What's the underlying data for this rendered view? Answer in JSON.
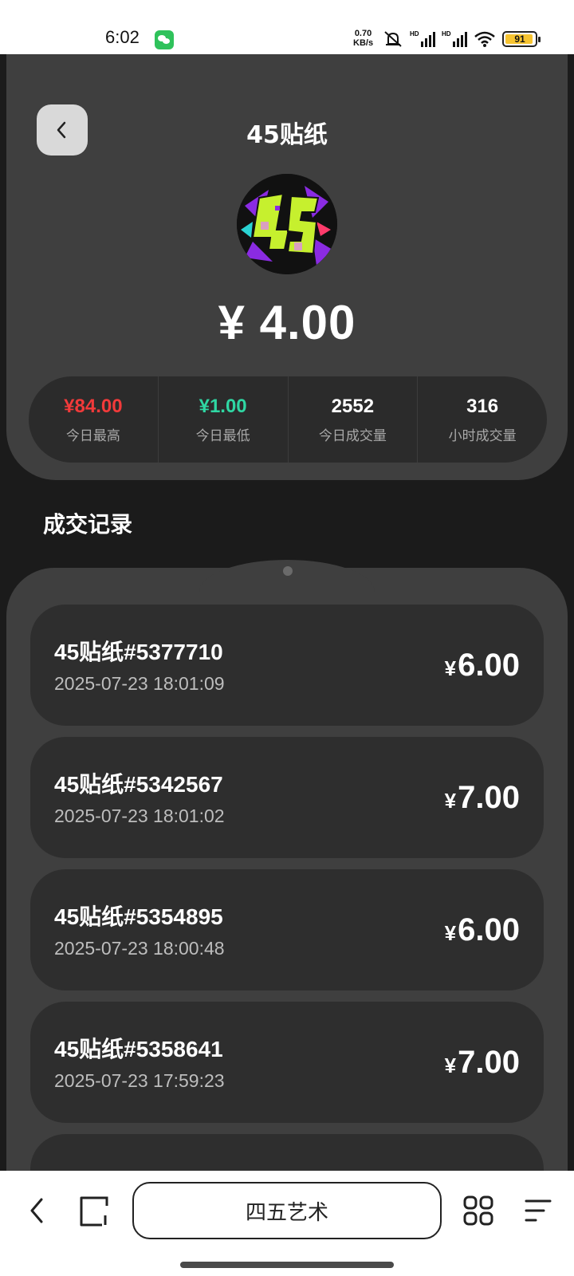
{
  "status_bar": {
    "time": "6:02",
    "net_speed_value": "0.70",
    "net_speed_unit": "KB/s",
    "battery": "91"
  },
  "header": {
    "title": "45贴纸",
    "price": "¥ 4.00"
  },
  "stats": [
    {
      "value": "¥84.00",
      "label": "今日最高",
      "color": "#f23a3a"
    },
    {
      "value": "¥1.00",
      "label": "今日最低",
      "color": "#2fd7a3"
    },
    {
      "value": "2552",
      "label": "今日成交量",
      "color": "#ffffff"
    },
    {
      "value": "316",
      "label": "小时成交量",
      "color": "#ffffff"
    }
  ],
  "section_title": "成交记录",
  "records": [
    {
      "name": "45贴纸#5377710",
      "time": "2025-07-23 18:01:09",
      "currency": "¥",
      "price": "6.00"
    },
    {
      "name": "45贴纸#5342567",
      "time": "2025-07-23 18:01:02",
      "currency": "¥",
      "price": "7.00"
    },
    {
      "name": "45贴纸#5354895",
      "time": "2025-07-23 18:00:48",
      "currency": "¥",
      "price": "6.00"
    },
    {
      "name": "45贴纸#5358641",
      "time": "2025-07-23 17:59:23",
      "currency": "¥",
      "price": "7.00"
    }
  ],
  "browser": {
    "address": "四五艺术"
  }
}
